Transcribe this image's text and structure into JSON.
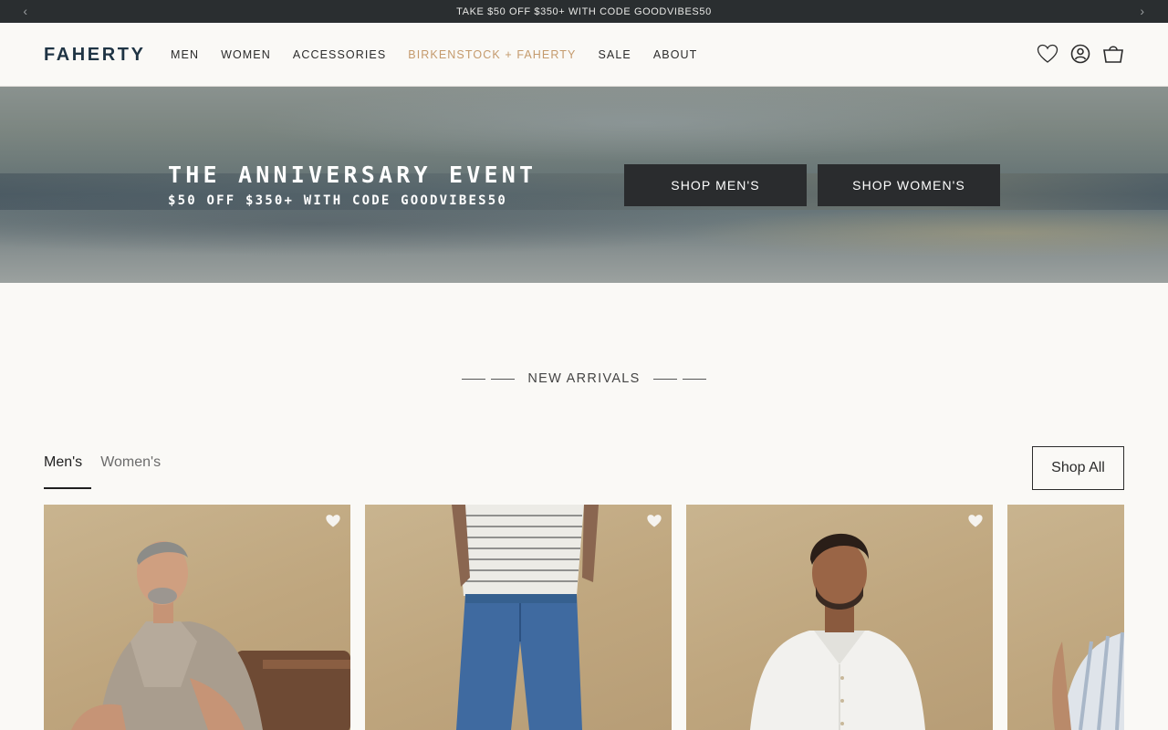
{
  "announcement": {
    "text": "TAKE $50 OFF $350+ WITH CODE GOODVIBES50",
    "prev_icon": "chevron-left-icon",
    "next_icon": "chevron-right-icon"
  },
  "header": {
    "logo": "FAHERTY",
    "nav": [
      {
        "label": "MEN"
      },
      {
        "label": "WOMEN"
      },
      {
        "label": "ACCESSORIES"
      },
      {
        "label": "BIRKENSTOCK + FAHERTY"
      },
      {
        "label": "SALE"
      },
      {
        "label": "ABOUT"
      }
    ],
    "accent_color": "#c49a6c",
    "icons": [
      "heart-icon",
      "account-icon",
      "bag-icon"
    ]
  },
  "hero": {
    "title": "THE ANNIVERSARY EVENT",
    "subtitle": "$50 OFF $350+ WITH CODE GOODVIBES50",
    "shop_mens": "SHOP MEN'S",
    "shop_womens": "SHOP WOMEN'S"
  },
  "new_arrivals": {
    "title": "NEW ARRIVALS",
    "tabs": [
      {
        "label": "Men's",
        "active": true
      },
      {
        "label": "Women's",
        "active": false
      }
    ],
    "shop_all": "Shop All"
  },
  "products": [
    {
      "image": "man-linen-shirt-seated"
    },
    {
      "image": "man-striped-tee-jeans"
    },
    {
      "image": "man-white-shirt"
    },
    {
      "image": "man-striped-short-sleeve"
    }
  ]
}
